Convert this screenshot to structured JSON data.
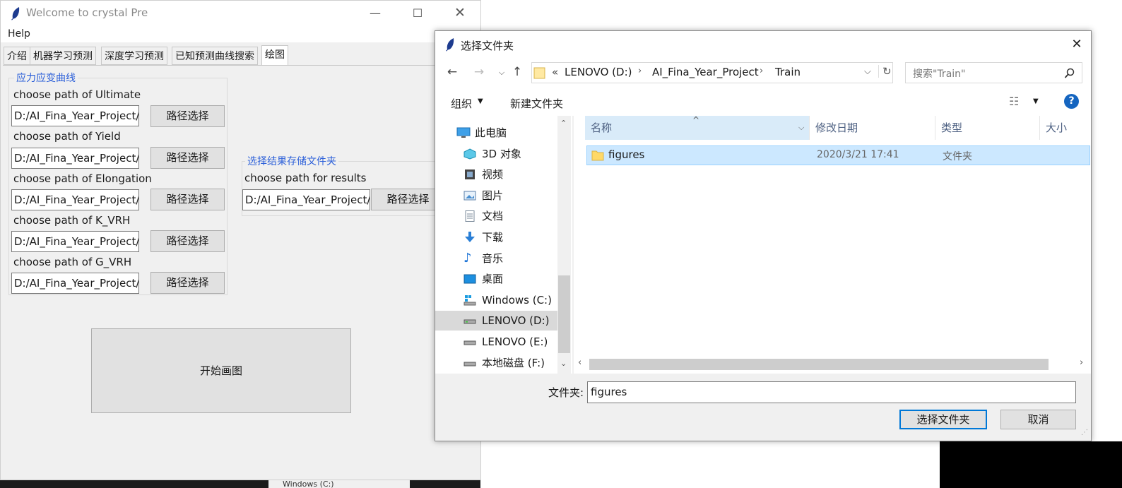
{
  "main_window": {
    "title": "Welcome to crystal Pre",
    "menu": {
      "help": "Help"
    },
    "tabs": [
      "介绍",
      "机器学习预测",
      "深度学习预测",
      "已知预测曲线搜索",
      "绘图"
    ],
    "active_tab": 4,
    "curve_group": {
      "title": "应力应变曲线",
      "rows": [
        {
          "label": "choose path of Ultimate",
          "value": "D:/AI_Fina_Year_Project/",
          "button": "路径选择"
        },
        {
          "label": "choose path of Yield",
          "value": "D:/AI_Fina_Year_Project/",
          "button": "路径选择"
        },
        {
          "label": "choose path of Elongation",
          "value": "D:/AI_Fina_Year_Project/",
          "button": "路径选择"
        },
        {
          "label": "choose path of K_VRH",
          "value": "D:/AI_Fina_Year_Project/",
          "button": "路径选择"
        },
        {
          "label": "choose path of G_VRH",
          "value": "D:/AI_Fina_Year_Project/",
          "button": "路径选择"
        }
      ]
    },
    "results_group": {
      "title": "选择结果存储文件夹",
      "label": "choose path for results",
      "value": "D:/AI_Fina_Year_Project/",
      "button": "路径选择"
    },
    "start_button": "开始画图"
  },
  "dialog": {
    "title": "选择文件夹",
    "address": {
      "prefix": "«",
      "crumbs": [
        "LENOVO (D:)",
        "AI_Fina_Year_Project",
        "Train"
      ]
    },
    "search_placeholder": "搜索\"Train\"",
    "toolbar": {
      "organize": "组织",
      "new_folder": "新建文件夹"
    },
    "nav_items": [
      {
        "label": "此电脑",
        "icon": "computer-icon"
      },
      {
        "label": "3D 对象",
        "icon": "3d-objects-icon"
      },
      {
        "label": "视频",
        "icon": "video-icon"
      },
      {
        "label": "图片",
        "icon": "pictures-icon"
      },
      {
        "label": "文档",
        "icon": "document-icon"
      },
      {
        "label": "下载",
        "icon": "download-icon"
      },
      {
        "label": "音乐",
        "icon": "music-icon"
      },
      {
        "label": "桌面",
        "icon": "desktop-icon"
      },
      {
        "label": "Windows (C:)",
        "icon": "windows-drive-icon"
      },
      {
        "label": "LENOVO (D:)",
        "icon": "drive-icon",
        "selected": true
      },
      {
        "label": "LENOVO (E:)",
        "icon": "drive-icon"
      },
      {
        "label": "本地磁盘 (F:)",
        "icon": "drive-icon"
      }
    ],
    "columns": [
      "名称",
      "修改日期",
      "类型",
      "大小"
    ],
    "files": [
      {
        "name": "figures",
        "date": "2020/3/21 17:41",
        "type": "文件夹",
        "size": ""
      }
    ],
    "folder_label": "文件夹:",
    "folder_value": "figures",
    "select_button": "选择文件夹",
    "cancel_button": "取消"
  },
  "taskbar_hint": "Windows (C:)",
  "colors": {
    "accent": "#0078d7",
    "group_title": "#2b5fd9",
    "selection": "#cce8ff"
  }
}
